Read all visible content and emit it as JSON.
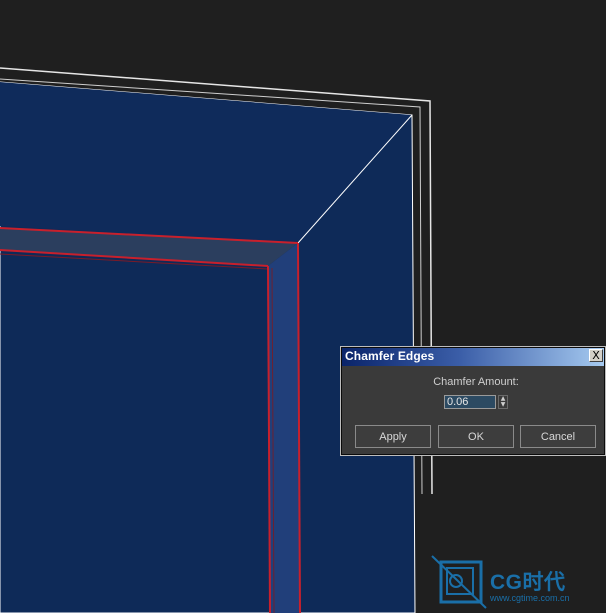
{
  "dialog": {
    "title": "Chamfer Edges",
    "close_label": "X",
    "amount_label": "Chamfer Amount:",
    "amount_value": "0.06",
    "apply_label": "Apply",
    "ok_label": "OK",
    "cancel_label": "Cancel"
  },
  "watermark": {
    "brand": "CG时代",
    "url": "www.cgtime.com.cn"
  },
  "colors": {
    "viewport_bg": "#1f1f1f",
    "object_face": "#0e2a58",
    "chamfer_face": "#213f7a",
    "selected_edge": "#c8202c",
    "wire": "#ffffff",
    "dialog_bg": "#3a3a3a",
    "titlebar": "#0a246a"
  },
  "icons": {
    "cursor": "mouse-pointer-icon",
    "spinner": "spinner-arrows-icon",
    "close": "close-icon",
    "logo": "cg-time-logo-icon"
  }
}
